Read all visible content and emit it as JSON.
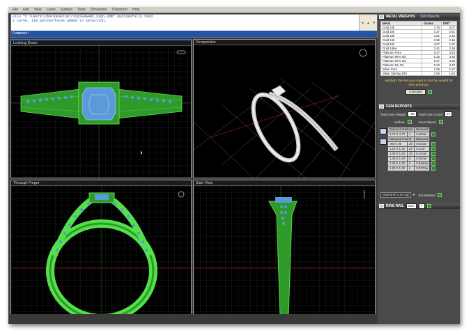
{
  "menu": [
    "File",
    "Edit",
    "View",
    "Curve",
    "Surface",
    "Tools",
    "Dimension",
    "Transform",
    "Help"
  ],
  "command": {
    "lines": [
      "File \"C:\\Users\\jdoe\\Desktop\\ring\\ENG4RX_sign.3dm\" successfully read",
      "1 curve, 118 polysurfaces added to selection."
    ],
    "prompt": "Command:"
  },
  "viewports": {
    "looking_down": "Looking Down",
    "perspective": "Perspective",
    "through_finger": "Through Finger",
    "side_view": "Side View"
  },
  "metal_weights": {
    "title": "METAL WEIGHTS",
    "subtitle": "118 Objects",
    "columns": [
      "Metal",
      "Grams",
      "DWT"
    ],
    "rows": [
      [
        "Gold 24k",
        "4.76",
        "3.07"
      ],
      [
        "Gold 22k",
        "4.37",
        "2.81"
      ],
      [
        "Gold 18k",
        "3.81",
        "2.45"
      ],
      [
        "Gold 14k",
        "3.35",
        "2.16"
      ],
      [
        "Gold 10k",
        "3.07",
        "1.97"
      ],
      [
        "Gold 14kw",
        "3.41",
        "2.19"
      ],
      [
        "Platinum Pure",
        "5.47",
        "3.52"
      ],
      [
        "Platinum 95% Irid",
        "5.36",
        "3.45"
      ],
      [
        "Platinum 90% Irid",
        "5.37",
        "3.45"
      ],
      [
        "Platinum 5% Ru",
        "5.33",
        "3.43"
      ],
      [
        "Silver Pure",
        "2.59",
        "1.67"
      ],
      [
        "Silver Sterling 925",
        "2.55",
        "1.64"
      ]
    ],
    "hint": "Highlight the item you want to find the weight for then press go.",
    "calculate_label": "Calculate"
  },
  "gem_reports": {
    "title": "GEM REPORTS",
    "total_weight_label": "Total Gem Weight",
    "total_weight_value": ".95",
    "total_count_label": "Total Gem Count",
    "total_count_value": "77",
    "update_label": "Update",
    "save_label": "Save Report",
    "center_stone": {
      "name": "Diamond Radiant",
      "type": "Diamond",
      "size": "4.70 X 4.70",
      "count": "1",
      "weight": "0.49ctw"
    },
    "side_header": {
      "name": "Diamond Round",
      "type": "Diamond"
    },
    "side_stones": [
      {
        "size": ".90 X .90",
        "count": "28",
        "weight": "0.04ctw"
      },
      {
        "size": "1.10 X 1.10",
        "count": "26",
        "weight": "0.1ctw"
      },
      {
        "size": "1.00 X 1.00",
        "count": "24",
        "weight": "0.14ctw"
      },
      {
        "size": "1.40 X 1.40",
        "count": "6",
        "weight": "0.15ctw"
      },
      {
        "size": "1.30 X 1.30",
        "count": "6",
        "weight": "0.048ctw"
      },
      {
        "size": "1.20 X 1.20",
        "count": "6",
        "weight": "0.037ctw"
      }
    ],
    "material_select": "Diamond (3.52 sg)",
    "set_material_label": "Set Material"
  },
  "ring_rail": {
    "title": "RING RAIL",
    "region": "USA",
    "size": "7"
  },
  "colors": {
    "wire": "#53e04a",
    "stones": "#5a9ad8",
    "grid": "#2b2b2b",
    "title_blue": "#2454a8"
  }
}
